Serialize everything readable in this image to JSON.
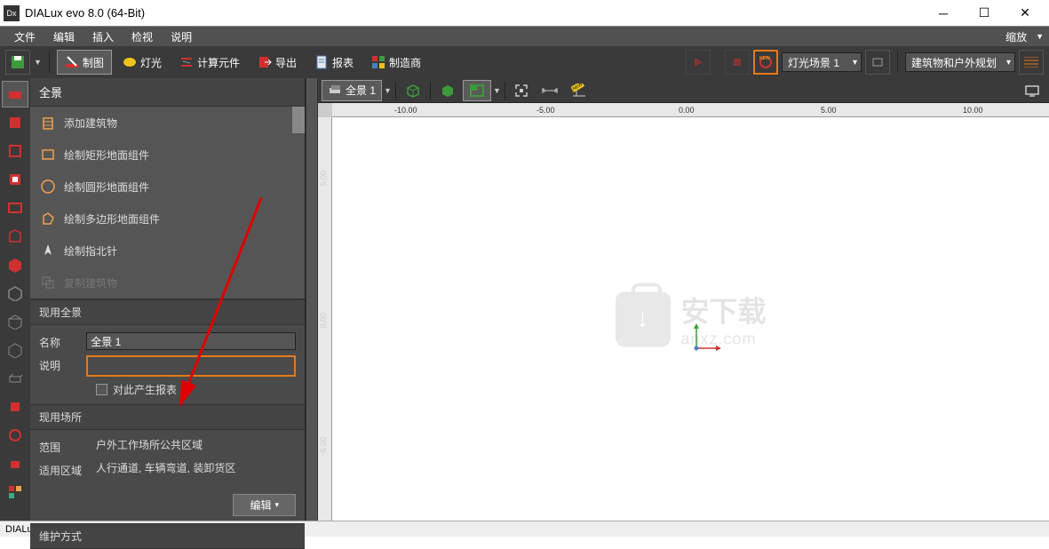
{
  "title": "DIALux evo 8.0  (64-Bit)",
  "menubar": [
    "文件",
    "编辑",
    "插入",
    "检视",
    "说明"
  ],
  "menubar_right": "缩放",
  "toolbar": {
    "tabs": [
      {
        "label": "制图",
        "color": "#d03030"
      },
      {
        "label": "灯光",
        "color": "#f0c417"
      },
      {
        "label": "计算元件",
        "color": "#d03030"
      },
      {
        "label": "导出",
        "color": "#d03030"
      },
      {
        "label": "报表",
        "color": "#4a7fc0"
      },
      {
        "label": "制造商",
        "color": "#multicolor"
      }
    ],
    "scene_dropdown": "灯光场景 1",
    "plan_dropdown": "建筑物和户外规划"
  },
  "panel": {
    "title": "全景",
    "items": [
      {
        "label": "添加建筑物",
        "icon": "building",
        "color": "#f0a050"
      },
      {
        "label": "绘制矩形地面组件",
        "icon": "rect",
        "color": "#f0a050"
      },
      {
        "label": "绘制圆形地面组件",
        "icon": "circle",
        "color": "#f0a050"
      },
      {
        "label": "绘制多边形地面组件",
        "icon": "polygon",
        "color": "#f0a050"
      },
      {
        "label": "绘制指北针",
        "icon": "compass",
        "color": "#ccc"
      },
      {
        "label": "复制建筑物",
        "icon": "copy",
        "color": "#777",
        "disabled": true
      }
    ],
    "section1": "现用全景",
    "name_label": "名称",
    "name_value": "全景 1",
    "desc_label": "说明",
    "desc_value": "",
    "checkbox_label": "对此产生报表",
    "section2": "现用场所",
    "scope_label": "范围",
    "scope_value": "户外工作场所公共区域",
    "area_label": "适用区域",
    "area_value": "人行通道, 车辆弯道, 装卸货区",
    "edit_btn": "编辑",
    "section3": "维护方式"
  },
  "viewport": {
    "scene_btn": "全景 1",
    "ruler_h": [
      "-10.00",
      "-5.00",
      "0.00",
      "5.00",
      "10.00"
    ],
    "ruler_v": [
      "5.00",
      "0.00",
      "-5.00"
    ]
  },
  "watermark": {
    "big": "安下载",
    "small": "anxz.com"
  },
  "statusbar": "DIALux evo"
}
